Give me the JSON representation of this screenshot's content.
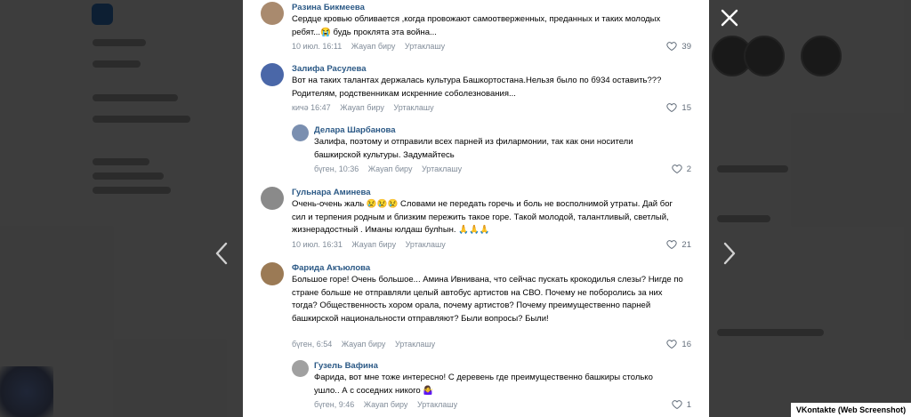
{
  "comments": [
    {
      "author": "Разина Бикмеева",
      "text": "Сердце кровью обливается ,когда провожают самоотверженных, преданных и таких молодых ребят...😭 будь проклята эта война...",
      "time": "10 июл. 16:11",
      "reply": "Жауап биру",
      "share": "Уртаклашу",
      "likes": "39"
    },
    {
      "author": "Залифа Расулева",
      "text": "Вот на таких талантах держалась культура Башкортостана.Нельзя было по б934 оставить??? Родителям, родственникам искренние соболезнования...",
      "time": "кичә 16:47",
      "reply": "Жауап биру",
      "share": "Уртаклашу",
      "likes": "15"
    },
    {
      "author": "Делара Шарбанова",
      "text": "Залифа, поэтому и отправили всех парней из филармонии, так как они носители башкирской культуры. Задумайтесь",
      "time": "бүген, 10:36",
      "reply": "Жауап биру",
      "share": "Уртаклашу",
      "likes": "2"
    },
    {
      "author": "Гульнара Аминева",
      "text": "Очень-очень жаль 😢😢😢 Словами не передать горечь и боль не восполнимой утраты. Дай бог сил и терпения родным и близким пережить такое горе. Такой молодой, талантливый, светлый, жизнерадостный . Иманы юлдаш булhын. 🙏🙏🙏",
      "time": "10 июл. 16:31",
      "reply": "Жауап биру",
      "share": "Уртаклашу",
      "likes": "21"
    },
    {
      "author": "Фарида Акъюлова",
      "text": "Большое горе! Очень большое... Амина Ивнивана, что сейчас пускать крокодилья слезы? Нигде по стране больше не отправляли целый автобус артистов на СВО. Почему не поборолись за них тогда? Общественность хором орала, почему артистов? Почему преимущественно парней башкирской национальности отправляют? Были вопросы? Были!",
      "time": "бүген, 6:54",
      "reply": "Жауап биру",
      "share": "Уртаклашу",
      "likes": "16"
    },
    {
      "author": "Гузель Вафина",
      "text": "Фарида, вот мне тоже интересно! С деревень где преимущественно башкиры столько ушло.. А с соседних никого 🤷‍♀️",
      "time": "бүген, 9:46",
      "reply": "Жауап биру",
      "share": "Уртаклашу",
      "likes": "1"
    }
  ],
  "caption": "VKontakte (Web Screenshot)",
  "colors": {
    "author": "#2a5885",
    "meta": "#818c99",
    "accent": "#2f6fb8"
  },
  "icons": {
    "close": "close-icon",
    "prev": "chevron-left-icon",
    "next": "chevron-right-icon",
    "like": "heart-icon"
  }
}
